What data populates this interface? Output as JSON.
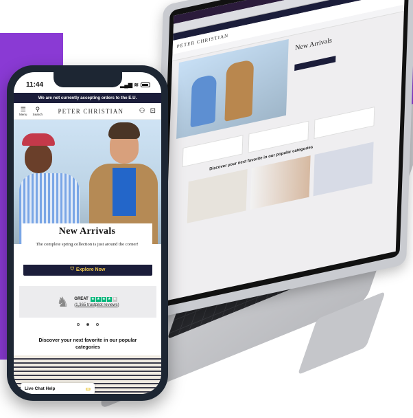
{
  "phone": {
    "status_time": "11:44",
    "status_icons": "▂▄▆ ≋",
    "notice": "We are not currently accepting orders to the E.U.",
    "header": {
      "menu_label": "Menu",
      "search_label": "Search",
      "brand": "PETER CHRISTIAN",
      "account_icon": "user-icon",
      "bag_icon": "bag-icon"
    },
    "hero": {
      "title": "New Arrivals",
      "subtitle": "The complete spring collection is just around the corner!",
      "button_label": "Explore Now"
    },
    "reviews": {
      "rating_word": "GREAT",
      "stars": 4.5,
      "count_text": "1,365 trustpilot reviews"
    },
    "carousel": {
      "dots": 3,
      "active": 1
    },
    "discover_heading": "Discover your next favorite in our popular categories",
    "chat_label": "Live Chat Help"
  },
  "laptop": {
    "brand": "PETER CHRISTIAN",
    "hero_title": "New Arrivals",
    "discover_heading": "Discover your next favorite in our popular categories"
  },
  "colors": {
    "accent_purple": "#8a3ad4",
    "navy": "#1b1d3a",
    "gold": "#f2c94c",
    "trustpilot_green": "#00b67a"
  }
}
